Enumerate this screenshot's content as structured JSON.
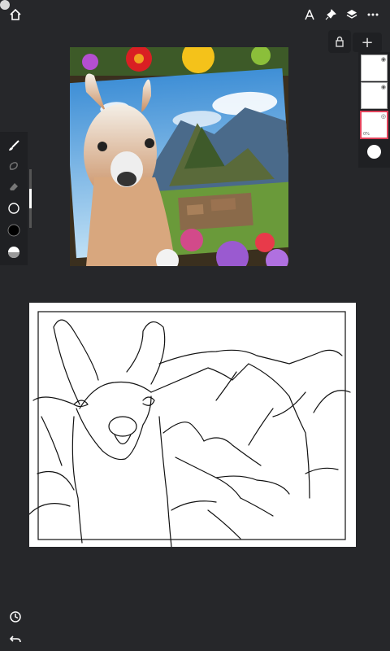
{
  "toolbar": {
    "home_icon": "home-icon",
    "right_icons": [
      "compass-icon",
      "pin-icon",
      "layers-icon",
      "more-icon"
    ],
    "add_label": "+"
  },
  "layers": {
    "items": [
      {
        "name": "layer-1",
        "visible": true
      },
      {
        "name": "layer-2",
        "visible": true
      },
      {
        "name": "layer-3",
        "visible": true,
        "selected": true,
        "opacity_label": "0%"
      }
    ],
    "current_color": "#ffffff",
    "selected_border_color": "#e0425a"
  },
  "tools": {
    "items": [
      "brush-icon",
      "smudge-icon",
      "eraser-icon",
      "brush-size-icon",
      "color-icon",
      "opacity-icon"
    ],
    "slider_level": 0.33
  },
  "bottom": {
    "icons": [
      "history-icon",
      "undo-icon"
    ]
  }
}
